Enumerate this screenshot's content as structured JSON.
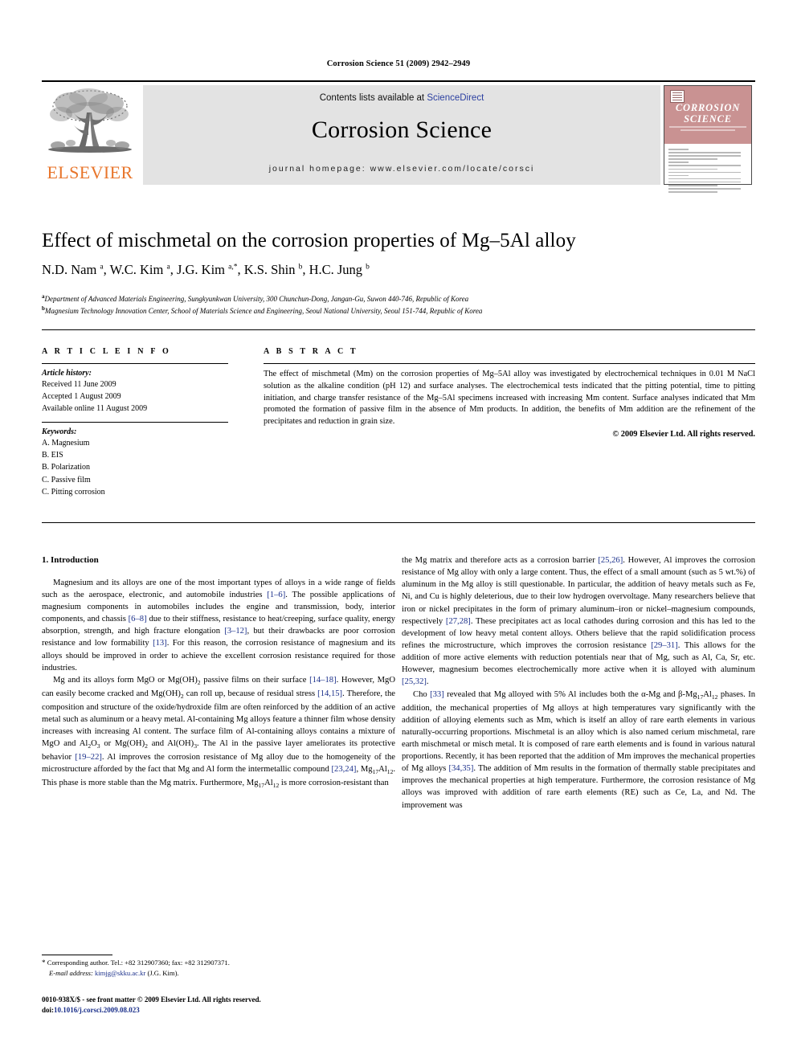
{
  "running_head": "Corrosion Science 51 (2009) 2942–2949",
  "masthead": {
    "contents_prefix": "Contents lists available at ",
    "sciencedirect": "ScienceDirect",
    "journal_name": "Corrosion Science",
    "homepage": "journal homepage: www.elsevier.com/locate/corsci",
    "publisher_wordmark": "ELSEVIER",
    "cover": {
      "line1": "CORROSION",
      "line2": "SCIENCE"
    }
  },
  "article": {
    "title": "Effect of mischmetal on the corrosion properties of Mg–5Al alloy",
    "authors_html": "N.D. Nam <sup>a</sup>, W.C. Kim <sup>a</sup>, J.G. Kim <sup>a,*</sup>, K.S. Shin <sup>b</sup>, H.C. Jung <sup>b</sup>",
    "affiliation_a": "Department of Advanced Materials Engineering, Sungkyunkwan University, 300 Chunchun-Dong, Jangan-Gu, Suwon 440-746, Republic of Korea",
    "affiliation_b": "Magnesium Technology Innovation Center, School of Materials Science and Engineering, Seoul National University, Seoul 151-744, Republic of Korea"
  },
  "info": {
    "heading": "A R T I C L E  I N F O",
    "history_label": "Article history:",
    "history": [
      "Received 11 June 2009",
      "Accepted 1 August 2009",
      "Available online 11 August 2009"
    ],
    "keywords_label": "Keywords:",
    "keywords": [
      "A. Magnesium",
      "B. EIS",
      "B. Polarization",
      "C. Passive film",
      "C. Pitting corrosion"
    ]
  },
  "abstract": {
    "heading": "A B S T R A C T",
    "text": "The effect of mischmetal (Mm) on the corrosion properties of Mg–5Al alloy was investigated by electrochemical techniques in 0.01 M NaCl solution as the alkaline condition (pH 12) and surface analyses. The electrochemical tests indicated that the pitting potential, time to pitting initiation, and charge transfer resistance of the Mg–5Al specimens increased with increasing Mm content. Surface analyses indicated that Mm promoted the formation of passive film in the absence of Mm products. In addition, the benefits of Mm addition are the refinement of the precipitates and reduction in grain size.",
    "copyright": "© 2009 Elsevier Ltd. All rights reserved."
  },
  "body": {
    "section_heading": "1. Introduction",
    "left_paragraph_1": "Magnesium and its alloys are one of the most important types of alloys in a wide range of fields such as the aerospace, electronic, and automobile industries [1–6]. The possible applications of magnesium components in automobiles includes the engine and transmission, body, interior components, and chassis [6–8] due to their stiffness, resistance to heat/creeping, surface quality, energy absorption, strength, and high fracture elongation [3–12], but their drawbacks are poor corrosion resistance and low formability [13]. For this reason, the corrosion resistance of magnesium and its alloys should be improved in order to achieve the excellent corrosion resistance required for those industries.",
    "left_paragraph_2": "Mg and its alloys form MgO or Mg(OH)2 passive films on their surface [14–18]. However, MgO can easily become cracked and Mg(OH)2 can roll up, because of residual stress [14,15]. Therefore, the composition and structure of the oxide/hydroxide film are often reinforced by the addition of an active metal such as aluminum or a heavy metal. Al-containing Mg alloys feature a thinner film whose density increases with increasing Al content. The surface film of Al-containing alloys contains a mixture of MgO and Al2O3 or Mg(OH)2 and Al(OH)3. The Al in the passive layer ameliorates its protective behavior [19–22]. Al improves the corrosion resistance of Mg alloy due to the homogeneity of the microstructure afforded by the fact that Mg and Al form the intermetallic compound [23,24], Mg17Al12. This phase is more stable than the Mg matrix. Furthermore, Mg17Al12 is more corrosion-resistant than",
    "right_paragraph_1": "the Mg matrix and therefore acts as a corrosion barrier [25,26]. However, Al improves the corrosion resistance of Mg alloy with only a large content. Thus, the effect of a small amount (such as 5 wt.%) of aluminum in the Mg alloy is still questionable. In particular, the addition of heavy metals such as Fe, Ni, and Cu is highly deleterious, due to their low hydrogen overvoltage. Many researchers believe that iron or nickel precipitates in the form of primary aluminum–iron or nickel–magnesium compounds, respectively [27,28]. These precipitates act as local cathodes during corrosion and this has led to the development of low heavy metal content alloys. Others believe that the rapid solidification process refines the microstructure, which improves the corrosion resistance [29–31]. This allows for the addition of more active elements with reduction potentials near that of Mg, such as Al, Ca, Sr, etc. However, magnesium becomes electrochemically more active when it is alloyed with aluminum [25,32].",
    "right_paragraph_2": "Cho [33] revealed that Mg alloyed with 5% Al includes both the α-Mg and β-Mg17Al12 phases. In addition, the mechanical properties of Mg alloys at high temperatures vary significantly with the addition of alloying elements such as Mm, which is itself an alloy of rare earth elements in various naturally-occurring proportions. Mischmetal is an alloy which is also named cerium mischmetal, rare earth mischmetal or misch metal. It is composed of rare earth elements and is found in various natural proportions. Recently, it has been reported that the addition of Mm improves the mechanical properties of Mg alloys [34,35]. The addition of Mm results in the formation of thermally stable precipitates and improves the mechanical properties at high temperature. Furthermore, the corrosion resistance of Mg alloys was improved with addition of rare earth elements (RE) such as Ce, La, and Nd. The improvement was"
  },
  "footnotes": {
    "corresponding": "Corresponding author. Tel.: +82 312907360; fax: +82 312907371.",
    "email_label": "E-mail address:",
    "email": "kimjg@skku.ac.kr",
    "email_suffix": "(J.G. Kim)."
  },
  "footer": {
    "issn_line": "0010-938X/$ - see front matter © 2009 Elsevier Ltd. All rights reserved.",
    "doi_label": "doi:",
    "doi": "10.1016/j.corsci.2009.08.023"
  },
  "colors": {
    "link_blue": "#1a2f8a",
    "sciencedirect_blue": "#2b3fa0",
    "elsevier_orange": "#E8762C",
    "masthead_grey": "#e3e3e3",
    "cover_salmon": "#c99292"
  }
}
